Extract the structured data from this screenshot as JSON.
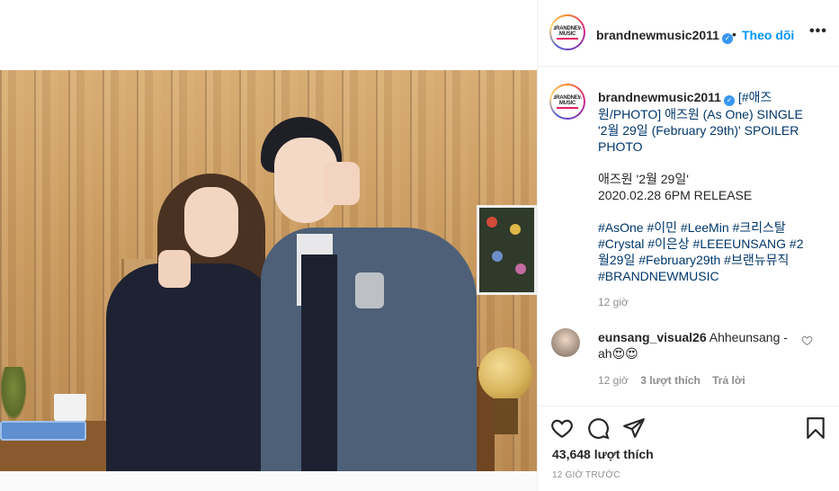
{
  "account": {
    "username": "brandnewmusic2011",
    "avatar_text_line1": "BRANDNEW",
    "avatar_text_line2": "MUSIC",
    "separator": "•",
    "follow_label": "Theo dõi",
    "more_label": "•••"
  },
  "caption": {
    "username": "brandnewmusic2011",
    "line1": "[#애즈원/PHOTO] 애즈원 (As One) SINGLE '2월 29일 (February 29th)' SPOILER PHOTO",
    "line2": "애즈원 '2월 29일'",
    "line3": "2020.02.28 6PM RELEASE",
    "hashtags": "#AsOne #이민 #LeeMin #크리스탈 #Crystal #이은상 #LEEEUNSANG #2월29일 #February29th #브랜뉴뮤직 #BRANDNEWMUSIC",
    "time": "12 giờ"
  },
  "comment": {
    "username": "eunsang_visual26",
    "text": "Ahheunsang - ah😍😍",
    "time": "12 giờ",
    "likes": "3 lượt thích",
    "reply": "Trả lời"
  },
  "actions": {
    "likes_count": "43,648 lượt thích",
    "posted_ago": "12 GIỜ TRƯỚC"
  },
  "colors": {
    "link_blue": "#0095f6",
    "hashtag_blue": "#00376b",
    "verified_blue": "#3897f0",
    "muted_gray": "#8e8e8e"
  },
  "icons": [
    "verified-icon",
    "more-icon",
    "heart-icon",
    "comment-icon",
    "share-icon",
    "bookmark-icon",
    "comment-heart-icon"
  ]
}
